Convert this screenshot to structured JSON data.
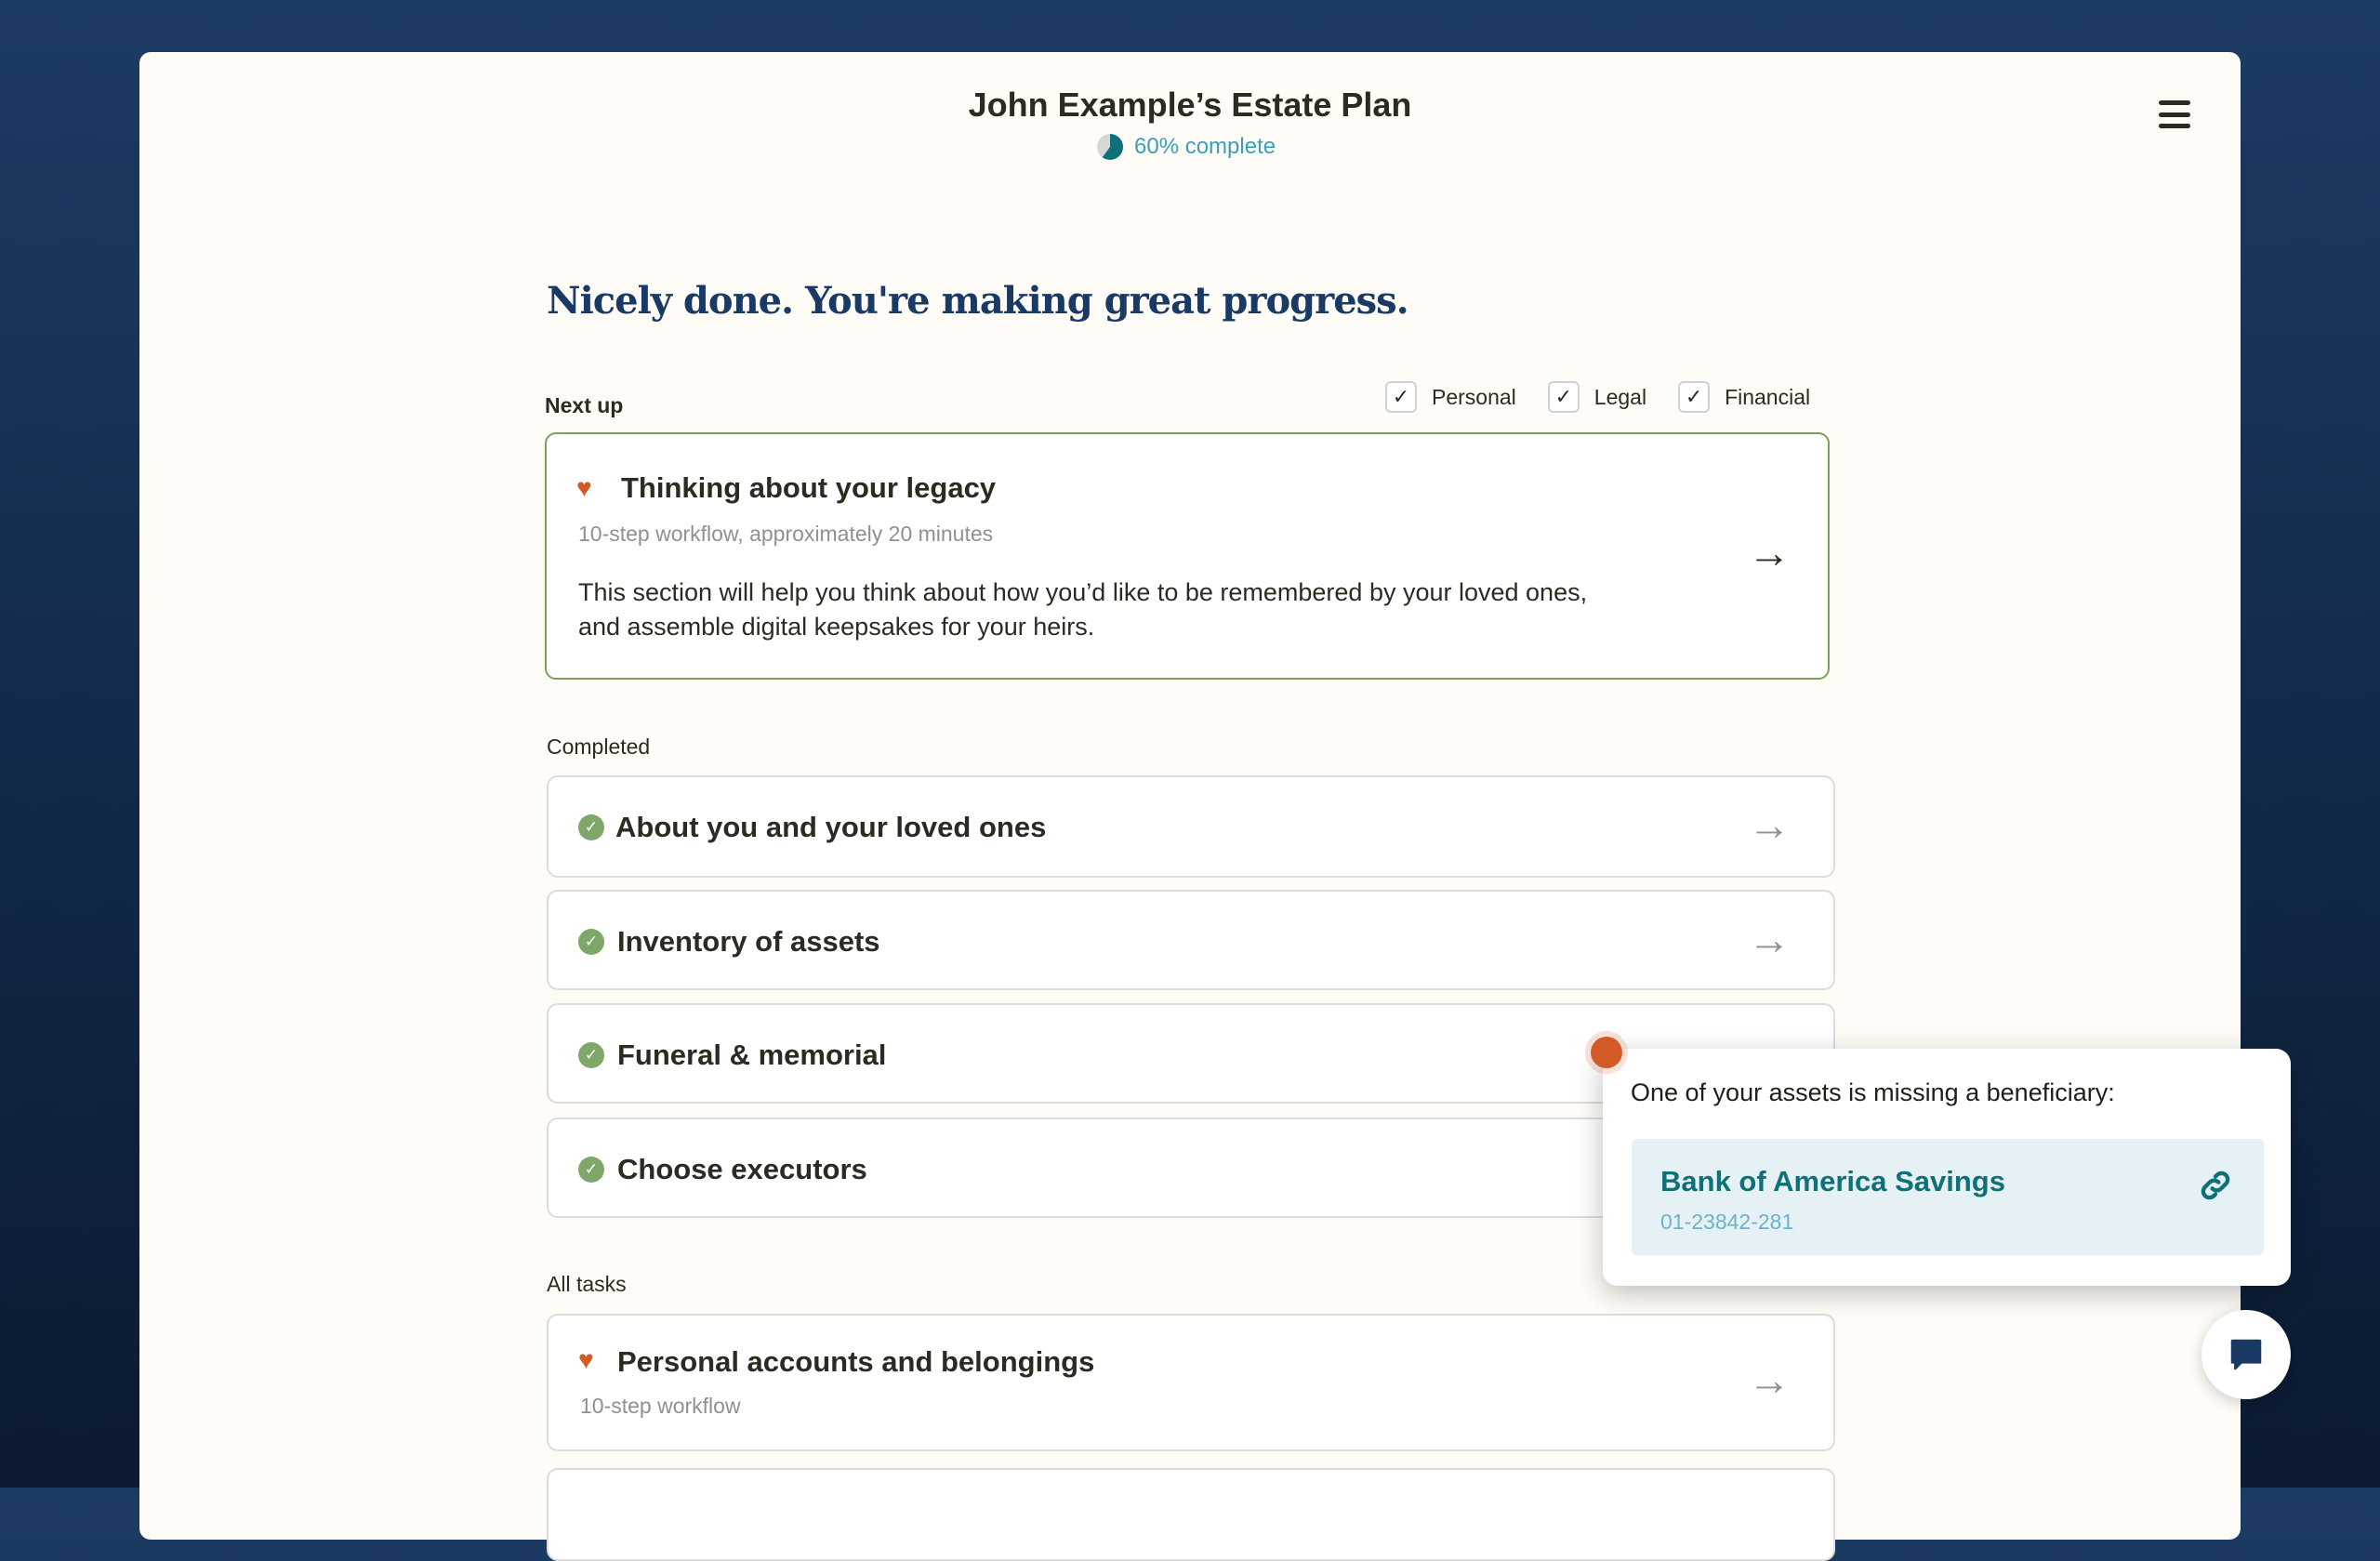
{
  "header": {
    "title": "John Example’s Estate Plan",
    "progress_label": "60% complete",
    "progress_fraction": 0.6,
    "menu_icon": "hamburger-icon"
  },
  "heading": "Nicely done. You're making great progress.",
  "next_up": {
    "label": "Next up",
    "title": "Thinking about your legacy",
    "meta": "10-step workflow, approximately 20 minutes",
    "description_line1": "This section will help you think about how you’d like to be remembered by your loved ones,",
    "description_line2": "and assemble digital keepsakes for your heirs.",
    "icon": "heart-icon"
  },
  "filters": [
    {
      "label": "Personal",
      "checked": true
    },
    {
      "label": "Legal",
      "checked": true
    },
    {
      "label": "Financial",
      "checked": true
    }
  ],
  "completed": {
    "label": "Completed",
    "items": [
      {
        "title": "About you and your loved ones"
      },
      {
        "title": "Inventory of assets"
      },
      {
        "title": "Funeral & memorial"
      },
      {
        "title": "Choose executors"
      }
    ]
  },
  "all_tasks": {
    "label": "All tasks",
    "items": [
      {
        "title": "Personal accounts and belongings",
        "meta": "10-step workflow"
      }
    ]
  },
  "popup": {
    "message": "One of your assets is missing a beneficiary:",
    "asset_name": "Bank of America Savings",
    "asset_number": "01-23842-281"
  },
  "colors": {
    "accent": "#0f7178",
    "navy": "#1a3a66",
    "alert": "#d35a27",
    "success": "#7ea86a",
    "next_border": "#7ba05b"
  }
}
